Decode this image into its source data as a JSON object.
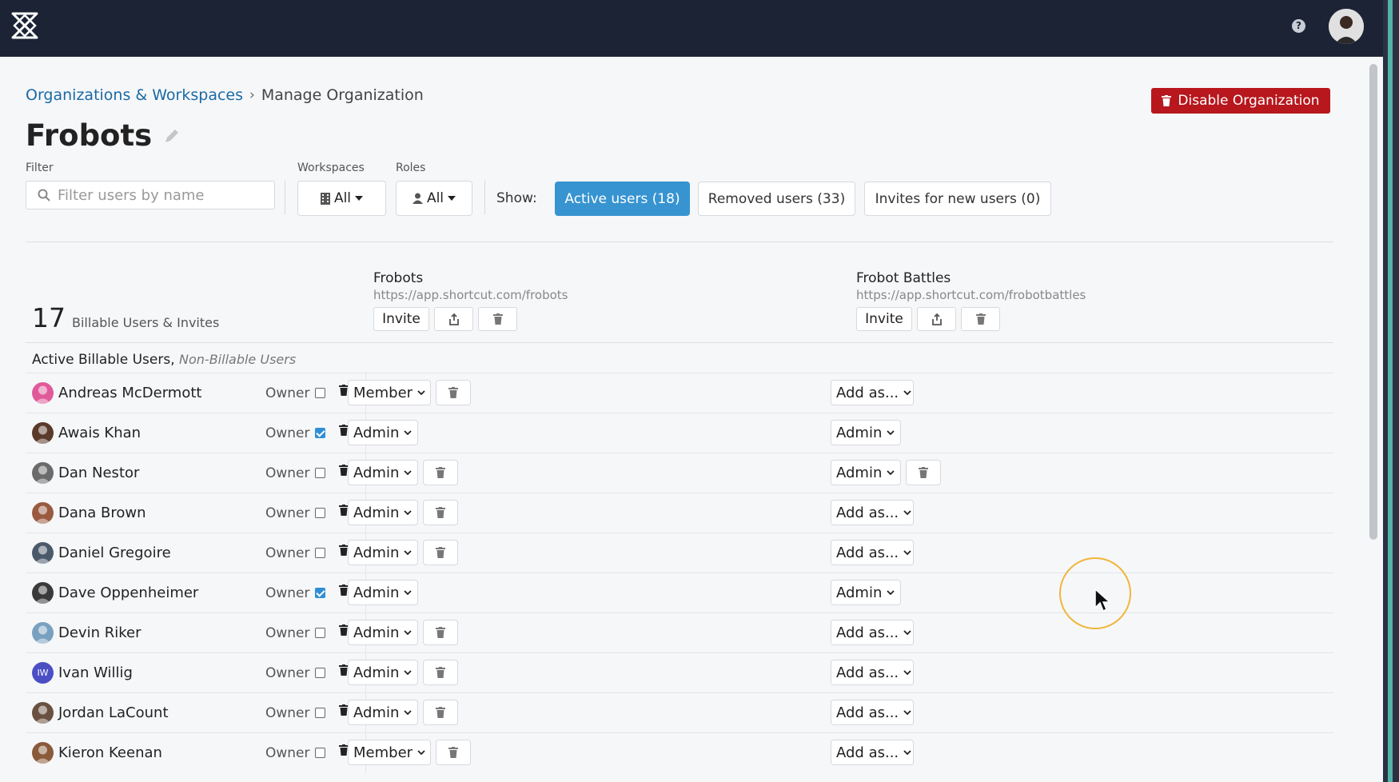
{
  "topbar": {
    "logo": "shortcut-logo-icon",
    "help": "?",
    "avatar": "user-avatar"
  },
  "breadcrumb": {
    "parent": "Organizations & Workspaces",
    "separator": "›",
    "current": "Manage Organization"
  },
  "actions": {
    "disable_org": "Disable Organization"
  },
  "org": {
    "name": "Frobots"
  },
  "filters": {
    "filter_label": "Filter",
    "filter_placeholder": "Filter users by name",
    "workspaces_label": "Workspaces",
    "workspaces_value": "All",
    "roles_label": "Roles",
    "roles_value": "All",
    "show_label": "Show:",
    "show_options": [
      {
        "label": "Active users (18)",
        "active": true
      },
      {
        "label": "Removed users (33)",
        "active": false
      },
      {
        "label": "Invites for new users (0)",
        "active": false
      }
    ]
  },
  "summary": {
    "count": "17",
    "count_label": "Billable Users & Invites"
  },
  "workspaces": [
    {
      "name": "Frobots",
      "url": "https://app.shortcut.com/frobots",
      "invite_label": "Invite"
    },
    {
      "name": "Frobot Battles",
      "url": "https://app.shortcut.com/frobotbattles",
      "invite_label": "Invite"
    }
  ],
  "section": {
    "title": "Active Billable Users,",
    "subtitle": "Non-Billable Users"
  },
  "owner_label": "Owner",
  "users": [
    {
      "name": "Andreas McDermott",
      "owner": false,
      "ws1_role": "Member",
      "ws1_trash": true,
      "ws2_role": "Add as...",
      "ws2_trash": false,
      "avatar_color": "#e05a9a",
      "initials": ""
    },
    {
      "name": "Awais Khan",
      "owner": true,
      "ws1_role": "Admin",
      "ws1_trash": false,
      "ws2_role": "Admin",
      "ws2_trash": false,
      "avatar_color": "#5a3a2a",
      "initials": ""
    },
    {
      "name": "Dan Nestor",
      "owner": false,
      "ws1_role": "Admin",
      "ws1_trash": true,
      "ws2_role": "Admin",
      "ws2_trash": true,
      "avatar_color": "#6b6b6b",
      "initials": ""
    },
    {
      "name": "Dana Brown",
      "owner": false,
      "ws1_role": "Admin",
      "ws1_trash": true,
      "ws2_role": "Add as...",
      "ws2_trash": false,
      "avatar_color": "#9a5a40",
      "initials": ""
    },
    {
      "name": "Daniel Gregoire",
      "owner": false,
      "ws1_role": "Admin",
      "ws1_trash": true,
      "ws2_role": "Add as...",
      "ws2_trash": false,
      "avatar_color": "#4a5a6a",
      "initials": ""
    },
    {
      "name": "Dave Oppenheimer",
      "owner": true,
      "ws1_role": "Admin",
      "ws1_trash": false,
      "ws2_role": "Admin",
      "ws2_trash": false,
      "avatar_color": "#3a3a3a",
      "initials": ""
    },
    {
      "name": "Devin Riker",
      "owner": false,
      "ws1_role": "Admin",
      "ws1_trash": true,
      "ws2_role": "Add as...",
      "ws2_trash": false,
      "avatar_color": "#7aa0c0",
      "initials": ""
    },
    {
      "name": "Ivan Willig",
      "owner": false,
      "ws1_role": "Admin",
      "ws1_trash": true,
      "ws2_role": "Add as...",
      "ws2_trash": false,
      "avatar_color": "#4b4fc4",
      "initials": "IW"
    },
    {
      "name": "Jordan LaCount",
      "owner": false,
      "ws1_role": "Admin",
      "ws1_trash": true,
      "ws2_role": "Add as...",
      "ws2_trash": false,
      "avatar_color": "#6a5040",
      "initials": ""
    },
    {
      "name": "Kieron Keenan",
      "owner": false,
      "ws1_role": "Member",
      "ws1_trash": true,
      "ws2_role": "Add as...",
      "ws2_trash": false,
      "avatar_color": "#8a5a3a",
      "initials": ""
    }
  ],
  "colors": {
    "topbar": "#1b2335",
    "accent": "#3794d1",
    "danger": "#b7171d",
    "link": "#1a6aa4"
  }
}
